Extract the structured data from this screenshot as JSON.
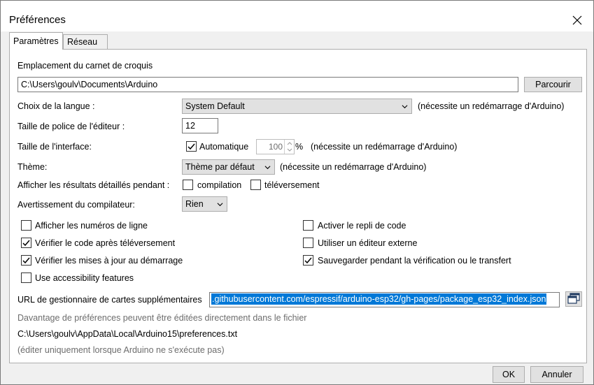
{
  "window": {
    "title": "Préférences",
    "close_glyph": "✕"
  },
  "tabs": [
    {
      "label": "Paramètres",
      "active": true
    },
    {
      "label": "Réseau",
      "active": false
    }
  ],
  "sketchbook": {
    "label": "Emplacement du carnet de croquis",
    "path": "C:\\Users\\goulv\\Documents\\Arduino",
    "browse_label": "Parcourir"
  },
  "language": {
    "label": "Choix de la langue :",
    "value": "System Default",
    "note": "(nécessite un redémarrage d'Arduino)"
  },
  "font_size": {
    "label": "Taille de police de l'éditeur :",
    "value": "12"
  },
  "interface_size": {
    "label": "Taille de l'interface:",
    "auto_label": "Automatique",
    "auto_checked": true,
    "value": "100",
    "unit": "%",
    "note": "(nécessite un redémarrage d'Arduino)"
  },
  "theme": {
    "label": "Thème:",
    "value": "Thème par défaut",
    "note": "(nécessite un redémarrage d'Arduino)"
  },
  "verbose": {
    "label": "Afficher les résultats détaillés pendant :",
    "compile_label": "compilation",
    "compile_checked": false,
    "upload_label": "téléversement",
    "upload_checked": false
  },
  "compiler_warnings": {
    "label": "Avertissement du compilateur:",
    "value": "Rien"
  },
  "options_left": [
    {
      "label": "Afficher les numéros de ligne",
      "checked": false
    },
    {
      "label": "Vérifier le code après téléversement",
      "checked": true
    },
    {
      "label": "Vérifier les mises à jour au démarrage",
      "checked": true
    },
    {
      "label": "Use accessibility features",
      "checked": false
    }
  ],
  "options_right": [
    {
      "label": "Activer le repli de code",
      "checked": false
    },
    {
      "label": "Utiliser un éditeur externe",
      "checked": false
    },
    {
      "label": "Sauvegarder pendant la vérification ou le transfert",
      "checked": true
    }
  ],
  "boards_url": {
    "label": "URL de gestionnaire de cartes supplémentaires",
    "value": ".githubusercontent.com/espressif/arduino-esp32/gh-pages/package_esp32_index.json"
  },
  "footer_text": {
    "info": "Davantage de préférences peuvent être éditées directement dans le fichier",
    "path": "C:\\Users\\goulv\\AppData\\Local\\Arduino15\\preferences.txt",
    "hint": "(éditer uniquement lorsque Arduino ne s'exécute pas)"
  },
  "buttons": {
    "ok_label": "OK",
    "cancel_label": "Annuler"
  }
}
